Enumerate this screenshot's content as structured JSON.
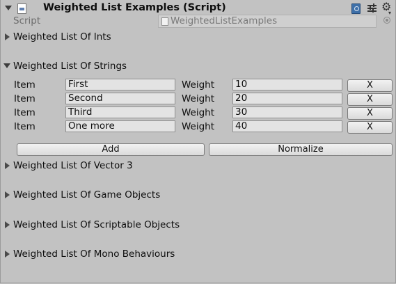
{
  "header": {
    "title": "Weighted List Examples (Script)",
    "enabled": true,
    "icons": [
      "component-icon",
      "help-book-icon",
      "preset-sliders-icon",
      "gear-icon"
    ]
  },
  "script": {
    "label": "Script",
    "value": "WeightedListExamples"
  },
  "sections": {
    "ints": "Weighted List Of Ints",
    "strings": "Weighted List Of Strings",
    "vector3": "Weighted List Of Vector 3",
    "gameobjects": "Weighted List Of Game Objects",
    "scriptables": "Weighted List Of Scriptable Objects",
    "monobehaviours": "Weighted List Of Mono Behaviours"
  },
  "strings_list": {
    "item_label": "Item",
    "weight_label": "Weight",
    "remove_label": "X",
    "items": [
      {
        "item": "First",
        "weight": "10"
      },
      {
        "item": "Second",
        "weight": "20"
      },
      {
        "item": "Third",
        "weight": "30"
      },
      {
        "item": "One more",
        "weight": "40"
      }
    ],
    "add_label": "Add",
    "normalize_label": "Normalize"
  }
}
